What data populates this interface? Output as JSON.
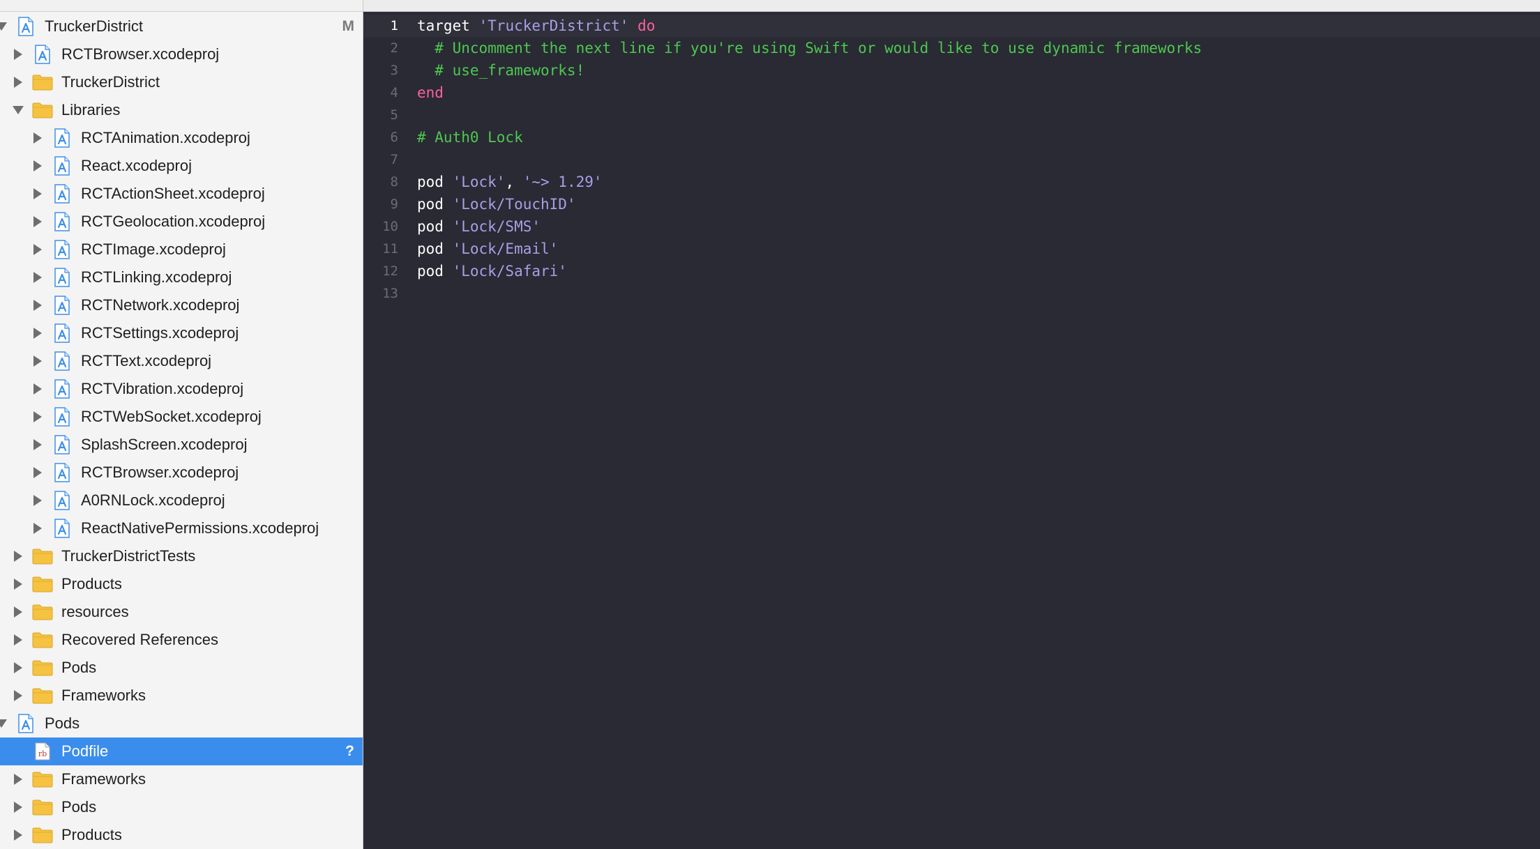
{
  "colors": {
    "selection": "#3b8ded",
    "editor_background": "#292a33",
    "keyword": "#fc5fa3",
    "string": "#a89fe8",
    "comment": "#4ec751",
    "folder": "#f5c242",
    "project_icon": "#3f8fe6"
  },
  "navigator": {
    "rows": [
      {
        "label": "TruckerDistrict",
        "icon": "xcodeproj-icon",
        "badge": "M"
      },
      {
        "label": "RCTBrowser.xcodeproj",
        "icon": "xcodeproj-icon"
      },
      {
        "label": "TruckerDistrict",
        "icon": "folder-icon"
      },
      {
        "label": "Libraries",
        "icon": "folder-icon"
      },
      {
        "label": "RCTAnimation.xcodeproj",
        "icon": "xcodeproj-icon"
      },
      {
        "label": "React.xcodeproj",
        "icon": "xcodeproj-icon"
      },
      {
        "label": "RCTActionSheet.xcodeproj",
        "icon": "xcodeproj-icon"
      },
      {
        "label": "RCTGeolocation.xcodeproj",
        "icon": "xcodeproj-icon"
      },
      {
        "label": "RCTImage.xcodeproj",
        "icon": "xcodeproj-icon"
      },
      {
        "label": "RCTLinking.xcodeproj",
        "icon": "xcodeproj-icon"
      },
      {
        "label": "RCTNetwork.xcodeproj",
        "icon": "xcodeproj-icon"
      },
      {
        "label": "RCTSettings.xcodeproj",
        "icon": "xcodeproj-icon"
      },
      {
        "label": "RCTText.xcodeproj",
        "icon": "xcodeproj-icon"
      },
      {
        "label": "RCTVibration.xcodeproj",
        "icon": "xcodeproj-icon"
      },
      {
        "label": "RCTWebSocket.xcodeproj",
        "icon": "xcodeproj-icon"
      },
      {
        "label": "SplashScreen.xcodeproj",
        "icon": "xcodeproj-icon"
      },
      {
        "label": "RCTBrowser.xcodeproj",
        "icon": "xcodeproj-icon"
      },
      {
        "label": "A0RNLock.xcodeproj",
        "icon": "xcodeproj-icon"
      },
      {
        "label": "ReactNativePermissions.xcodeproj",
        "icon": "xcodeproj-icon"
      },
      {
        "label": "TruckerDistrictTests",
        "icon": "folder-icon"
      },
      {
        "label": "Products",
        "icon": "folder-icon"
      },
      {
        "label": "resources",
        "icon": "folder-icon"
      },
      {
        "label": "Recovered References",
        "icon": "folder-icon"
      },
      {
        "label": "Pods",
        "icon": "folder-icon"
      },
      {
        "label": "Frameworks",
        "icon": "folder-icon"
      },
      {
        "label": "Pods",
        "icon": "xcodeproj-icon"
      },
      {
        "label": "Podfile",
        "icon": "ruby-file-icon",
        "badge": "?",
        "icon_text": "rb"
      },
      {
        "label": "Frameworks",
        "icon": "folder-icon"
      },
      {
        "label": "Pods",
        "icon": "folder-icon"
      },
      {
        "label": "Products",
        "icon": "folder-icon"
      }
    ]
  },
  "editor": {
    "current_line": 1,
    "lines": [
      {
        "num": "1",
        "tokens": [
          {
            "t": "target ",
            "c": "plain"
          },
          {
            "t": "'TruckerDistrict'",
            "c": "str"
          },
          {
            "t": " ",
            "c": "plain"
          },
          {
            "t": "do",
            "c": "kw"
          }
        ]
      },
      {
        "num": "2",
        "tokens": [
          {
            "t": "  # Uncomment the next line if you're using Swift or would like to use dynamic frameworks",
            "c": "cmt"
          }
        ]
      },
      {
        "num": "3",
        "tokens": [
          {
            "t": "  # use_frameworks!",
            "c": "cmt"
          }
        ]
      },
      {
        "num": "4",
        "tokens": [
          {
            "t": "end",
            "c": "kw"
          }
        ]
      },
      {
        "num": "5",
        "tokens": []
      },
      {
        "num": "6",
        "tokens": [
          {
            "t": "# Auth0 Lock",
            "c": "cmt"
          }
        ]
      },
      {
        "num": "7",
        "tokens": []
      },
      {
        "num": "8",
        "tokens": [
          {
            "t": "pod ",
            "c": "plain"
          },
          {
            "t": "'Lock'",
            "c": "str"
          },
          {
            "t": ", ",
            "c": "plain"
          },
          {
            "t": "'~> 1.29'",
            "c": "str"
          }
        ]
      },
      {
        "num": "9",
        "tokens": [
          {
            "t": "pod ",
            "c": "plain"
          },
          {
            "t": "'Lock/TouchID'",
            "c": "str"
          }
        ]
      },
      {
        "num": "10",
        "tokens": [
          {
            "t": "pod ",
            "c": "plain"
          },
          {
            "t": "'Lock/SMS'",
            "c": "str"
          }
        ]
      },
      {
        "num": "11",
        "tokens": [
          {
            "t": "pod ",
            "c": "plain"
          },
          {
            "t": "'Lock/Email'",
            "c": "str"
          }
        ]
      },
      {
        "num": "12",
        "tokens": [
          {
            "t": "pod ",
            "c": "plain"
          },
          {
            "t": "'Lock/Safari'",
            "c": "str"
          }
        ]
      },
      {
        "num": "13",
        "tokens": []
      }
    ]
  }
}
